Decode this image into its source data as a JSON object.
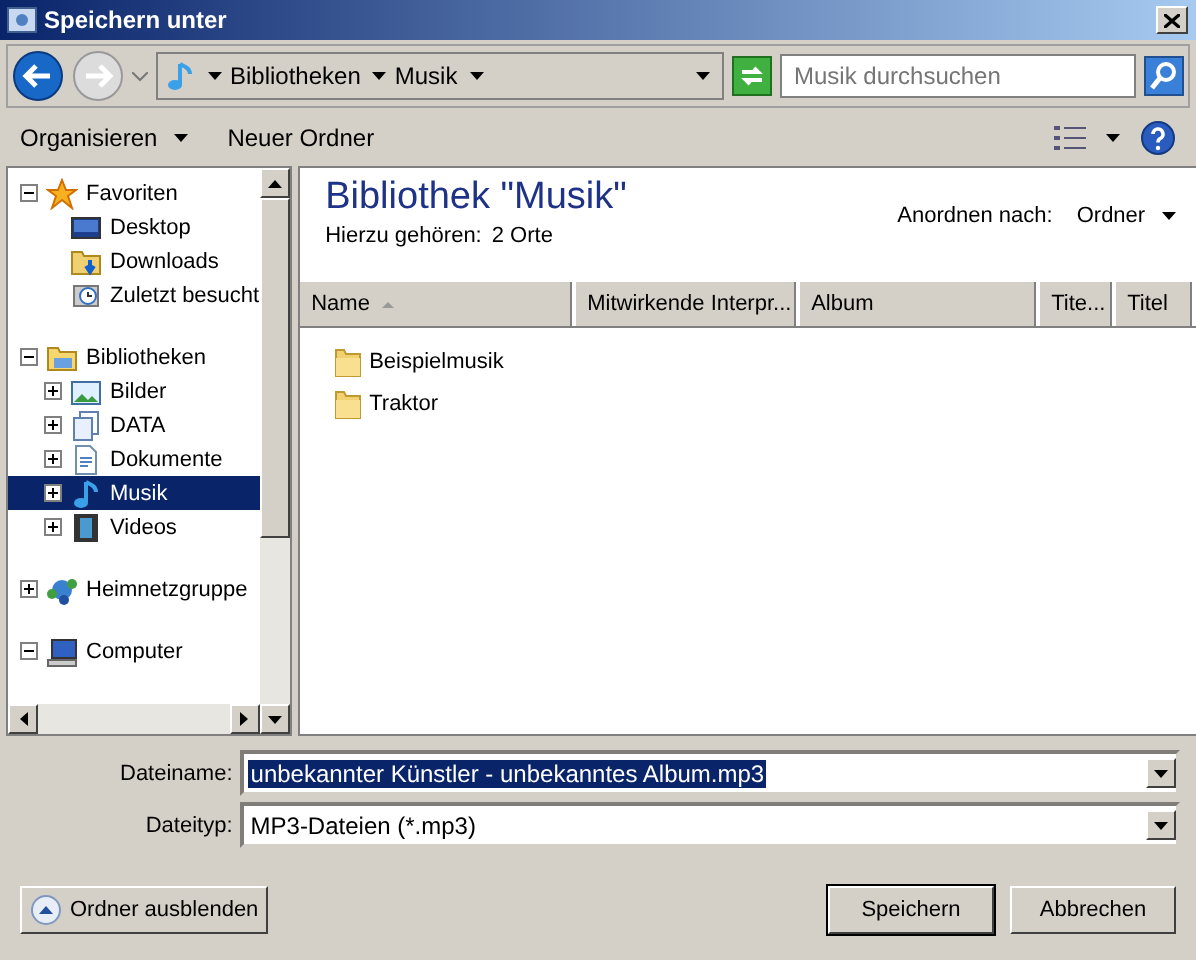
{
  "window": {
    "title": "Speichern unter"
  },
  "address": {
    "crumbs": [
      "Bibliotheken",
      "Musik"
    ]
  },
  "search": {
    "placeholder": "Musik durchsuchen"
  },
  "commands": [
    {
      "label": "Organisieren",
      "dropdown": true
    },
    {
      "label": "Neuer Ordner",
      "dropdown": false
    }
  ],
  "tree": [
    {
      "label": "Favoriten",
      "kind": "star",
      "expanded": true,
      "selected": false,
      "children": [
        {
          "label": "Desktop",
          "kind": "desktop",
          "selected": false
        },
        {
          "label": "Downloads",
          "kind": "downloads",
          "selected": false
        },
        {
          "label": "Zuletzt besucht",
          "kind": "recent",
          "selected": false
        }
      ]
    },
    {
      "label": "Bibliotheken",
      "kind": "library",
      "expanded": true,
      "selected": false,
      "children": [
        {
          "label": "Bilder",
          "kind": "pictures",
          "expanded": false,
          "selected": false
        },
        {
          "label": "DATA",
          "kind": "data",
          "expanded": false,
          "selected": false
        },
        {
          "label": "Dokumente",
          "kind": "documents",
          "expanded": false,
          "selected": false
        },
        {
          "label": "Musik",
          "kind": "music",
          "expanded": false,
          "selected": true
        },
        {
          "label": "Videos",
          "kind": "videos",
          "expanded": false,
          "selected": false
        }
      ]
    },
    {
      "label": "Heimnetzgruppe",
      "kind": "network",
      "expanded": false,
      "selected": false
    },
    {
      "label": "Computer",
      "kind": "computer",
      "expanded": true,
      "selected": false
    }
  ],
  "library": {
    "title": "Bibliothek \"Musik\"",
    "includes_label": "Hierzu gehören:",
    "includes_value": "2 Orte",
    "arrange_label": "Anordnen nach:",
    "arrange_value": "Ordner"
  },
  "table": {
    "columns": [
      {
        "label": "Name",
        "sorted": true
      },
      {
        "label": "Mitwirkende Interpr...",
        "sorted": false
      },
      {
        "label": "Album",
        "sorted": false
      },
      {
        "label": "Tite...",
        "sorted": false
      },
      {
        "label": "Titel",
        "sorted": false
      }
    ],
    "rows": [
      {
        "name": "Beispielmusik"
      },
      {
        "name": "Traktor"
      }
    ]
  },
  "form": [
    {
      "label": "Dateiname:",
      "value": "unbekannter Künstler - unbekanntes Album.mp3",
      "selected": true
    },
    {
      "label": "Dateityp:",
      "value": "MP3-Dateien (*.mp3)",
      "selected": false
    }
  ],
  "hide_folders": {
    "label": "Ordner ausblenden"
  },
  "buttons": [
    {
      "label": "Speichern",
      "default": true
    },
    {
      "label": "Abbrechen",
      "default": false
    }
  ]
}
